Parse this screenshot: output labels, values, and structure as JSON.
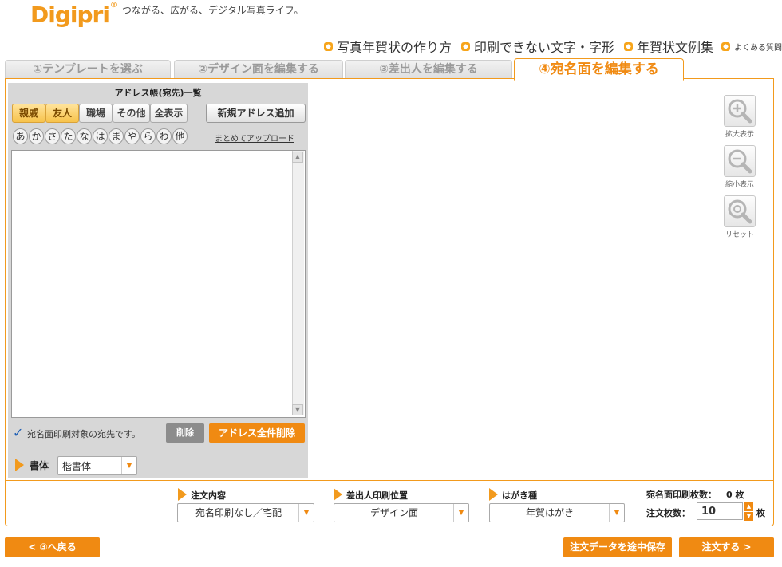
{
  "header": {
    "logo": "Digipri",
    "tagline": "つながる、広がる、デジタル写真ライフ。",
    "links": [
      "写真年賀状の作り方",
      "印刷できない文字・字形",
      "年賀状文例集"
    ],
    "faq": "よくある質問"
  },
  "tabs": [
    "①テンプレートを選ぶ",
    "②デザイン面を編集する",
    "③差出人を編集する",
    "④宛名面を編集する"
  ],
  "address_book": {
    "title": "アドレス帳(宛先)一覧",
    "categories": [
      "親戚",
      "友人",
      "職場",
      "その他",
      "全表示"
    ],
    "new_address": "新規アドレス追加",
    "kana": [
      "あ",
      "か",
      "さ",
      "た",
      "な",
      "は",
      "ま",
      "や",
      "ら",
      "わ",
      "他"
    ],
    "bulk_upload": "まとめてアップロード",
    "check_mark": "✓",
    "note": "宛名面印刷対象の宛先です。",
    "delete": "削除",
    "delete_all": "アドレス全件削除"
  },
  "font": {
    "label": "書体",
    "value": "楷書体"
  },
  "zoom": {
    "zoom_in": "拡大表示",
    "zoom_out": "縮小表示",
    "reset": "リセット"
  },
  "order": {
    "content_label": "注文内容",
    "content_value": "宛名印刷なし／宅配",
    "sender_pos_label": "差出人印刷位置",
    "sender_pos_value": "デザイン面",
    "card_type_label": "はがき種",
    "card_type_value": "年賀はがき",
    "print_count_label": "宛名面印刷枚数：",
    "print_count_value": "0 枚",
    "order_count_label": "注文枚数：",
    "order_count_value": "10",
    "unit": "枚"
  },
  "footer": {
    "back": "< ③へ戻る",
    "save": "注文データを途中保存",
    "order": "注文する >"
  },
  "colors": {
    "accent": "#f08a12",
    "highlight_button": "#f7c34c",
    "panel_gray": "#d7d7d7"
  }
}
